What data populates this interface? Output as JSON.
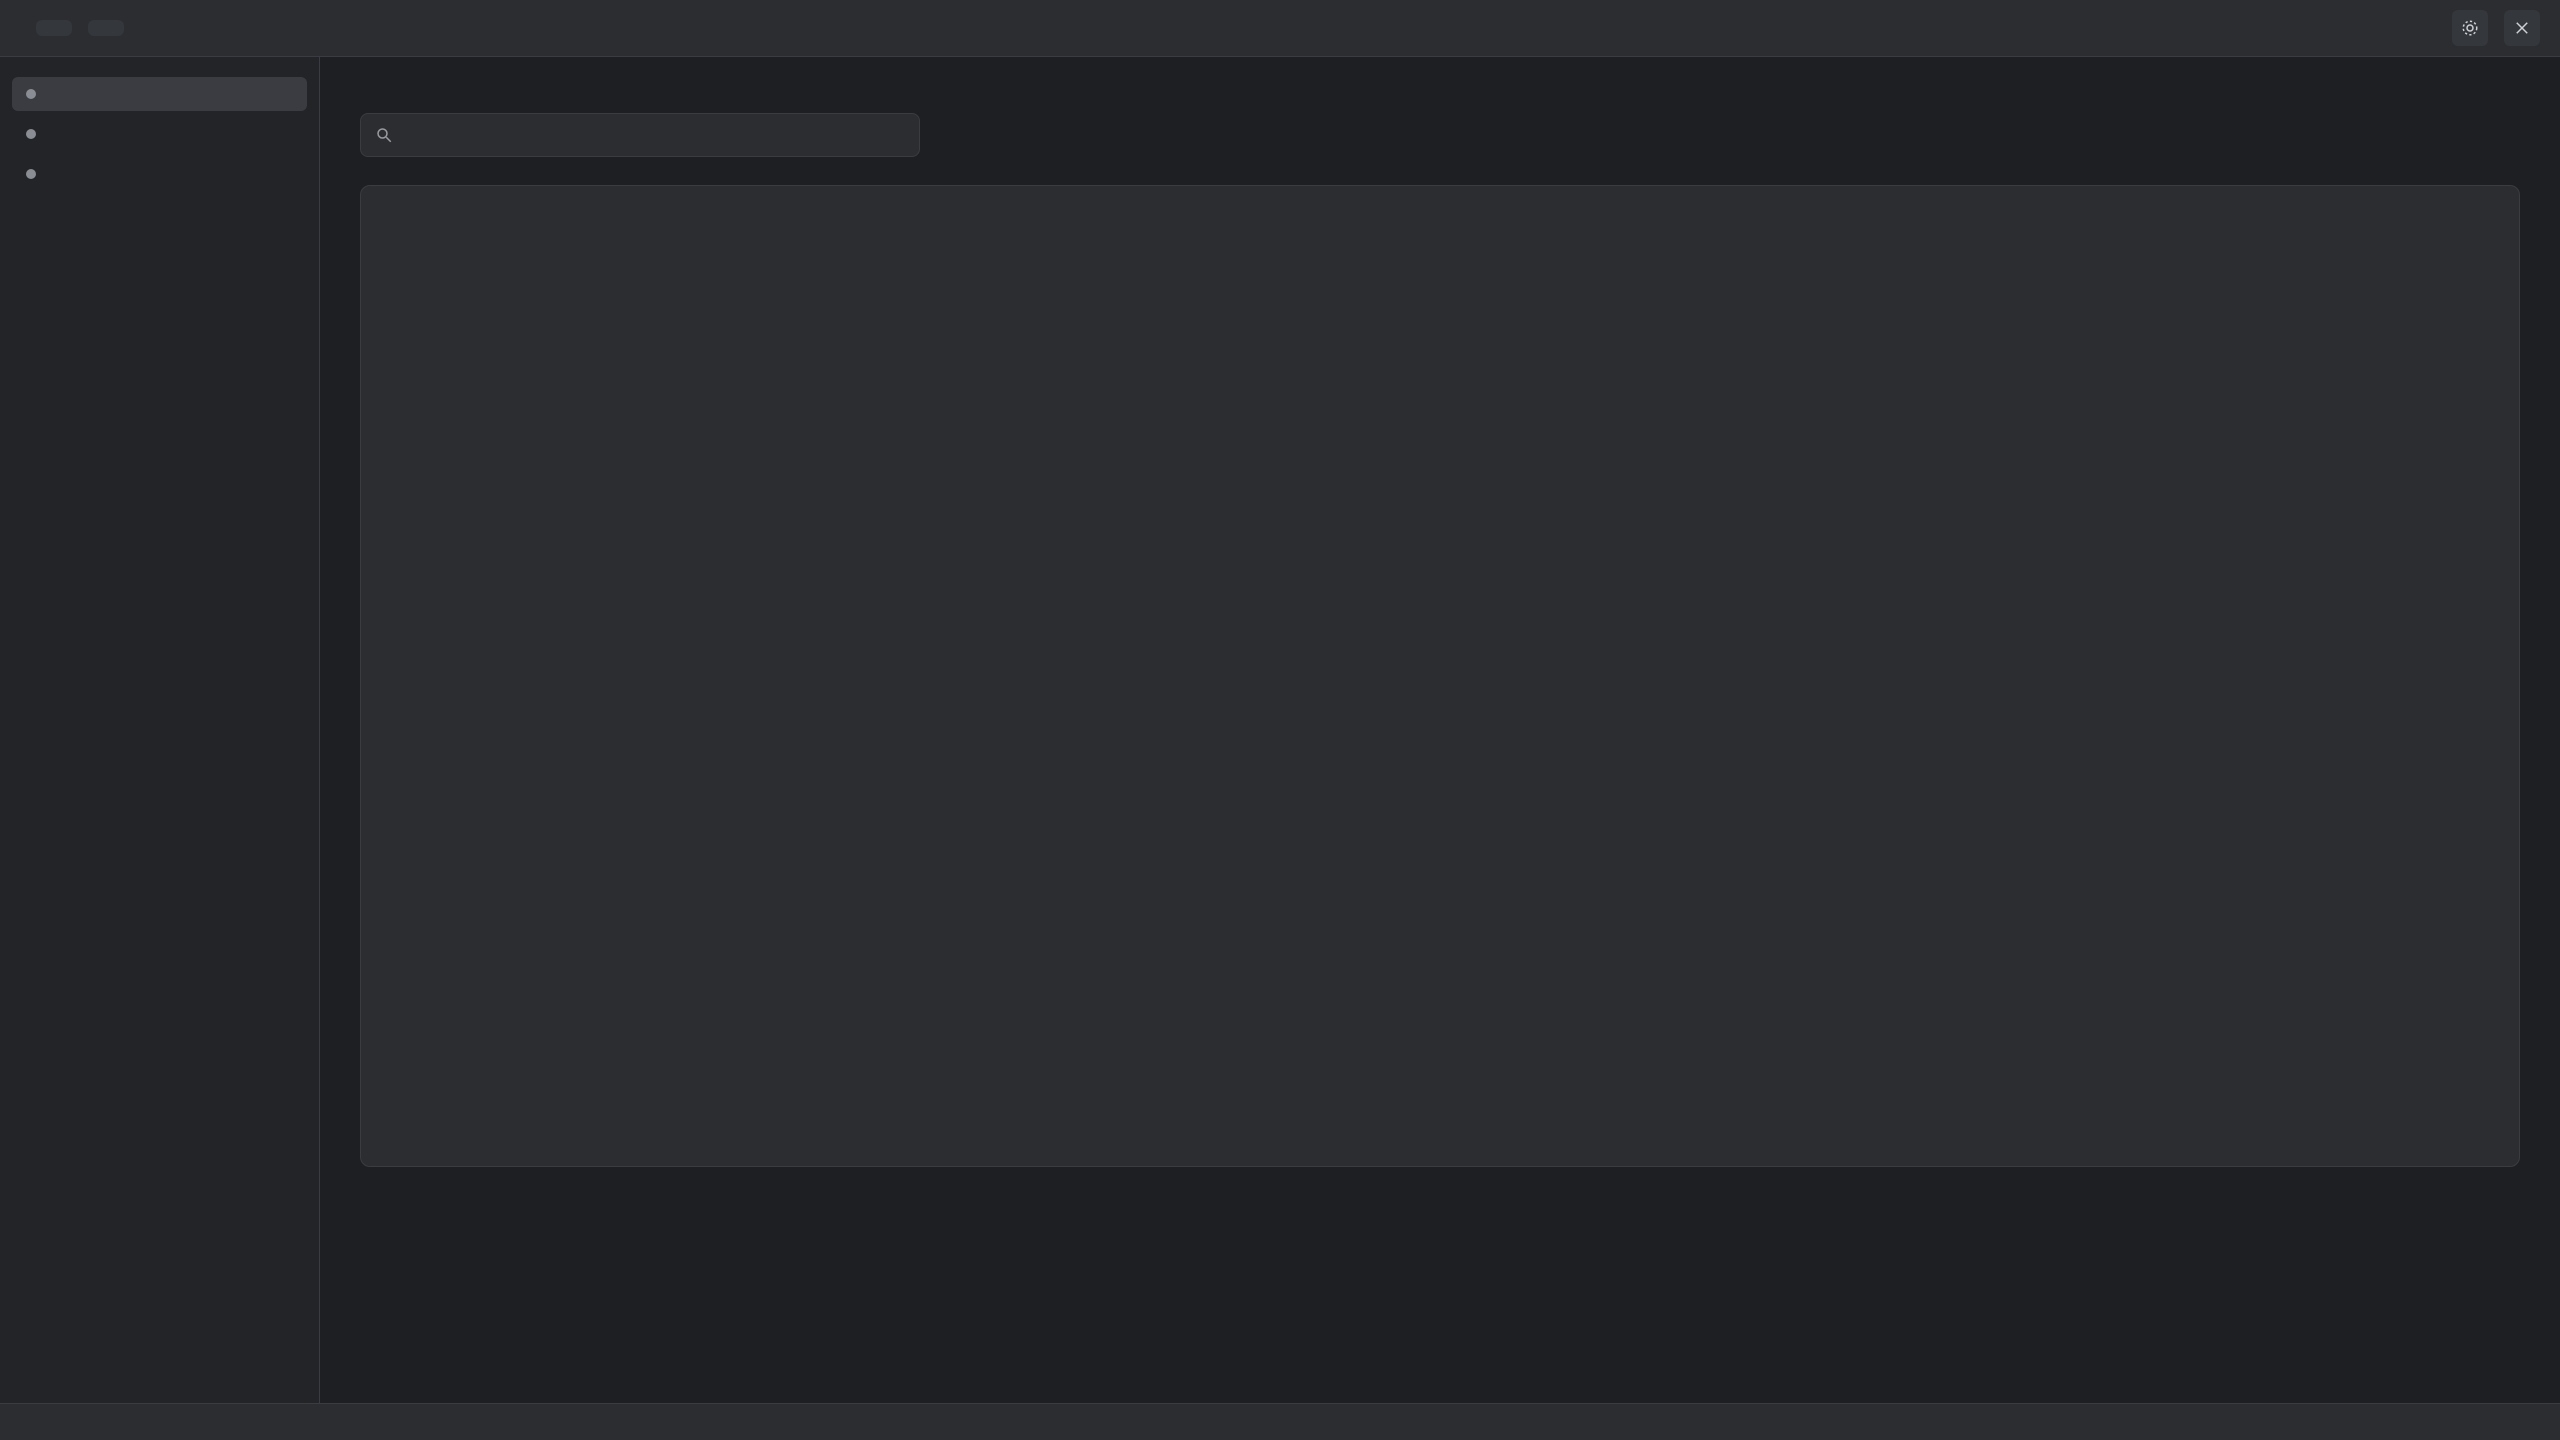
{
  "header": {
    "title": "",
    "tabs": []
  },
  "sidebar": {
    "items": []
  },
  "main": {
    "title": "",
    "panel_text": ""
  },
  "search": {
    "placeholder": ""
  },
  "statusbar": {
    "text": ""
  },
  "icons": {
    "settings": "gear-icon",
    "close": "close-icon",
    "search": "search-icon"
  }
}
